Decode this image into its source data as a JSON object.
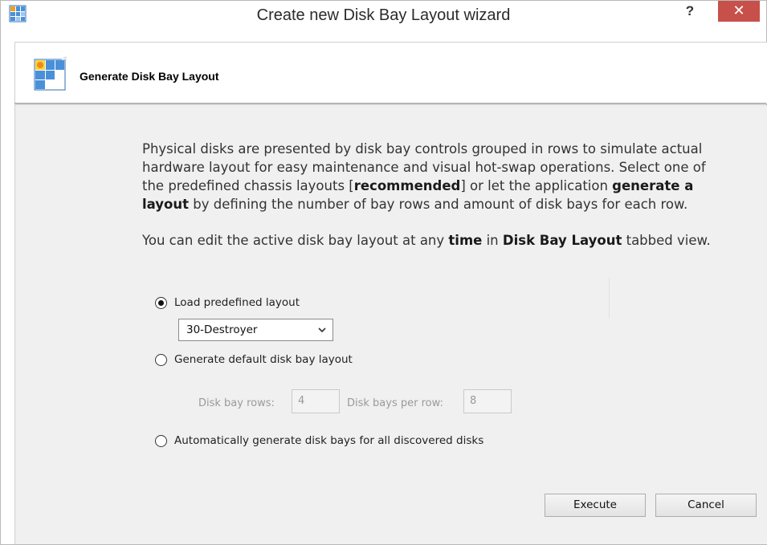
{
  "window": {
    "title": "Create new Disk Bay Layout wizard",
    "help_label": "?",
    "close_label": "✕",
    "app_icon": "disk-bay-grid-icon"
  },
  "header": {
    "title": "Generate Disk Bay Layout",
    "icon": "disk-bay-wizard-icon"
  },
  "description": {
    "p1": {
      "t1": "Physical disks are presented by disk bay controls grouped in rows to simulate actual hardware layout for easy maintenance and visual hot-swap operations. Select one of the predefined chassis layouts [",
      "b1": "recommended",
      "t2": "] or let the application ",
      "b2": "generate a layout",
      "t3": " by defining the number of bay rows and amount of disk bays for each row."
    },
    "p2": {
      "t1": "You can edit the active disk bay layout at any ",
      "b1": "time",
      "t2": " in ",
      "b2": "Disk Bay Layout",
      "t3": " tabbed view."
    }
  },
  "options": {
    "load_predefined": {
      "label": "Load predefined layout",
      "selected": true
    },
    "predefined_select": {
      "value": "30-Destroyer",
      "icon": "chevron-down-icon"
    },
    "generate_default": {
      "label": "Generate default disk bay layout",
      "selected": false
    },
    "rows": {
      "label": "Disk bay rows:",
      "value": "4"
    },
    "per_row": {
      "label": "Disk bays per row:",
      "value": "8"
    },
    "auto_generate": {
      "label": "Automatically generate disk bays for all discovered disks",
      "selected": false
    }
  },
  "buttons": {
    "execute": "Execute",
    "cancel": "Cancel"
  },
  "colors": {
    "close_button": "#c7504a",
    "content_background": "#f0f0f0",
    "icon_blue": "#3f86d3",
    "icon_orange": "#f0a020"
  }
}
